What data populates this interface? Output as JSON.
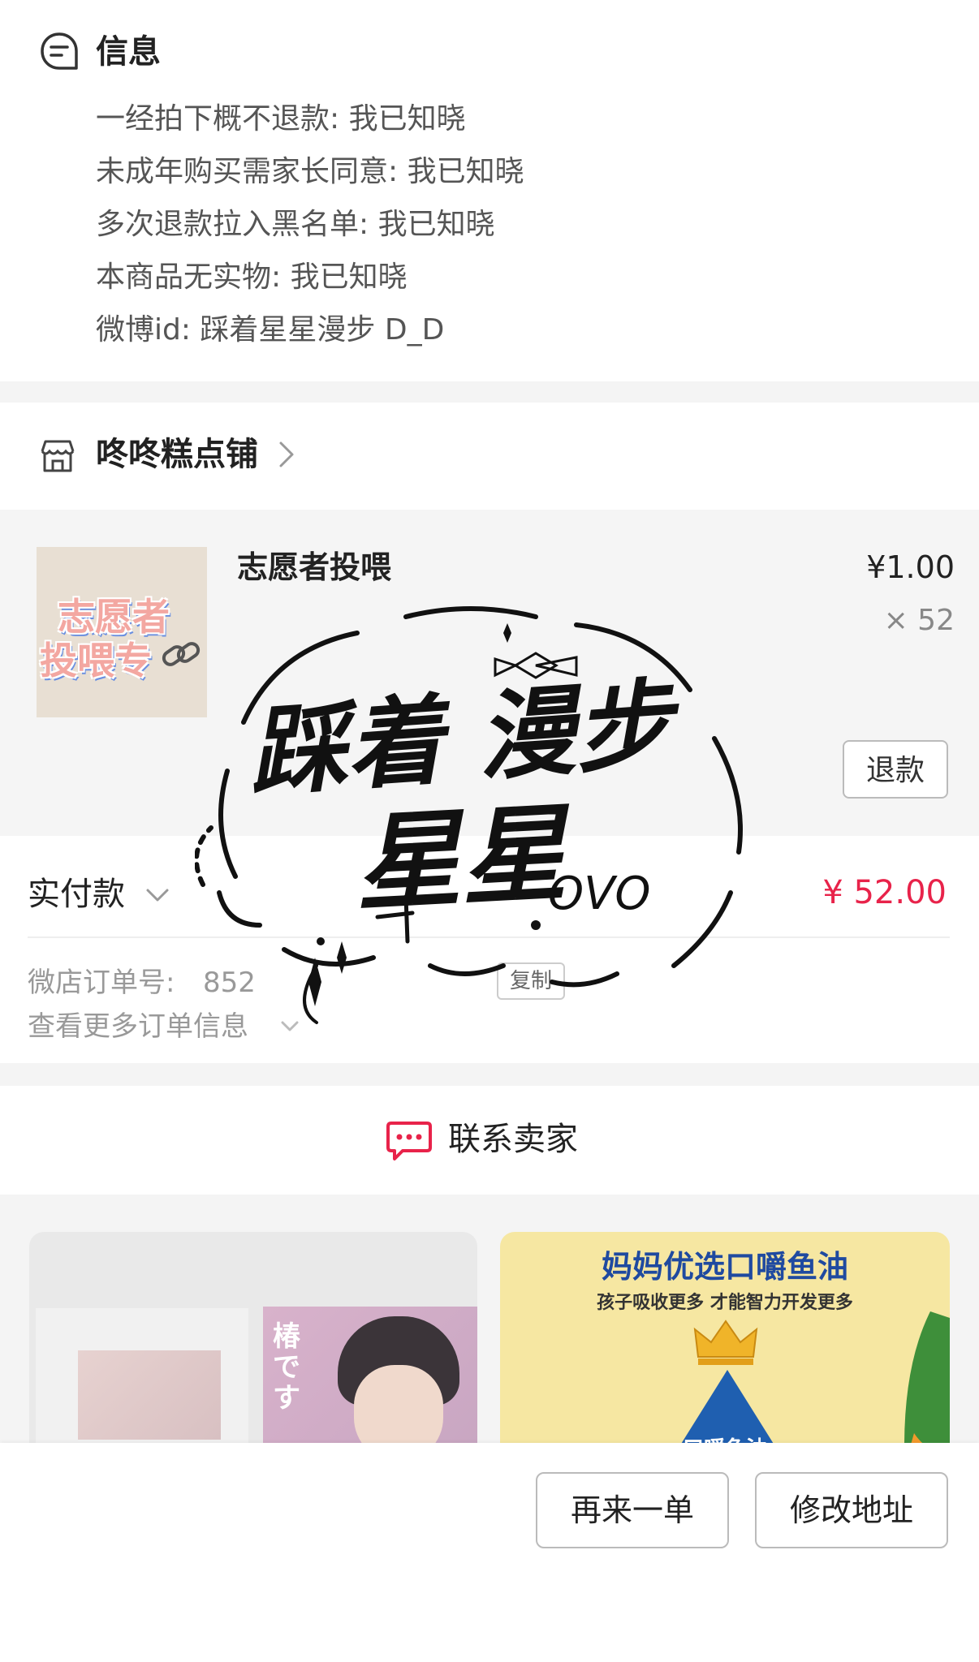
{
  "info": {
    "title": "信息",
    "lines": [
      "一经拍下概不退款: 我已知晓",
      "未成年购买需家长同意: 我已知晓",
      "多次退款拉入黑名单: 我已知晓",
      "本商品无实物: 我已知晓",
      "微博id: 踩着星星漫步 D_D"
    ]
  },
  "shop": {
    "name": "咚咚糕点铺"
  },
  "product": {
    "title": "志愿者投喂",
    "thumb_text": [
      "志愿者",
      "投喂专"
    ],
    "price": "¥1.00",
    "quantity": "× 52",
    "refund_label": "退款"
  },
  "payment": {
    "label": "实付款",
    "amount": "¥ 52.00",
    "order_no_label": "微店订单号:",
    "order_no": "852",
    "copy_label": "复制",
    "more_info_label": "查看更多订单信息"
  },
  "contact": {
    "label": "联系卖家"
  },
  "ads": {
    "left": {
      "vertical_text": "椿です"
    },
    "right": {
      "title": "妈妈优选口嚼鱼油",
      "subtitle": "孩子吸收更多 才能智力开发更多",
      "product_label": "口嚼鱼油"
    }
  },
  "bottom_bar": {
    "reorder_label": "再来一单",
    "address_label": "修改地址"
  },
  "signature": {
    "line1": "踩着 漫步",
    "line2": "星星",
    "tail": "OVO"
  },
  "colors": {
    "accent": "#e8234a",
    "card_bg": "#f5f5f5"
  }
}
